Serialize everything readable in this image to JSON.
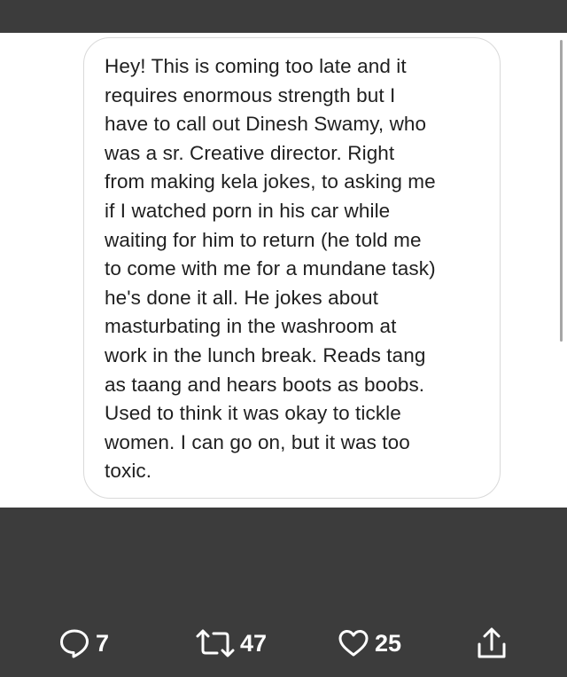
{
  "message": {
    "text": "Hey! This is coming too late and it\nrequires enormous strength but I\nhave to call out Dinesh Swamy, who\nwas a sr. Creative director. Right\nfrom making kela jokes, to asking me\nif I watched porn in his car while\nwaiting for him to return (he told me\nto come with me for a mundane task)\nhe's done it all. He jokes about\nmasturbating in the washroom at\nwork in the lunch break. Reads tang\nas taang and hears boots as boobs.\nUsed to think it was okay to tickle\nwomen. I can go on, but it was too\ntoxic."
  },
  "actions": {
    "reply": {
      "icon": "speech-bubble-icon",
      "count": "7"
    },
    "retweet": {
      "icon": "retweet-icon",
      "count": "47"
    },
    "like": {
      "icon": "heart-icon",
      "count": "25"
    },
    "share": {
      "icon": "share-upload-icon"
    }
  },
  "colors": {
    "background_dark": "#3c3c3c",
    "panel": "#ffffff",
    "bubble_border": "#d9d9d9",
    "text": "#1f1f1f",
    "action_text": "#ffffff"
  }
}
